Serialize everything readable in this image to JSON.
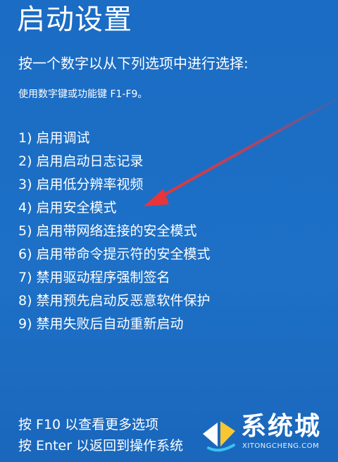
{
  "screen": {
    "title": "启动设置",
    "prompt": "按一个数字以从下列选项中进行选择:",
    "hint": "使用数字键或功能键 F1-F9。"
  },
  "options": [
    "1) 启用调试",
    "2) 启用启动日志记录",
    "3) 启用低分辨率视频",
    "4) 启用安全模式",
    "5) 启用带网络连接的安全模式",
    "6) 启用带命令提示符的安全模式",
    "7) 禁用驱动程序强制签名",
    "8) 禁用预先启动反恶意软件保护",
    "9) 禁用失败后自动重新启动"
  ],
  "footer": {
    "more_options": "按 F10 以查看更多选项",
    "return_os": "按 Enter 以返回到操作系统"
  },
  "watermark": {
    "brand": "系统城",
    "domain": "XITONGCHENG.COM"
  },
  "colors": {
    "background": "#1e6fc4",
    "text": "#ffffff",
    "arrow": "#e8353a"
  },
  "annotation": {
    "arrow_target_option": "4) 启用安全模式"
  }
}
